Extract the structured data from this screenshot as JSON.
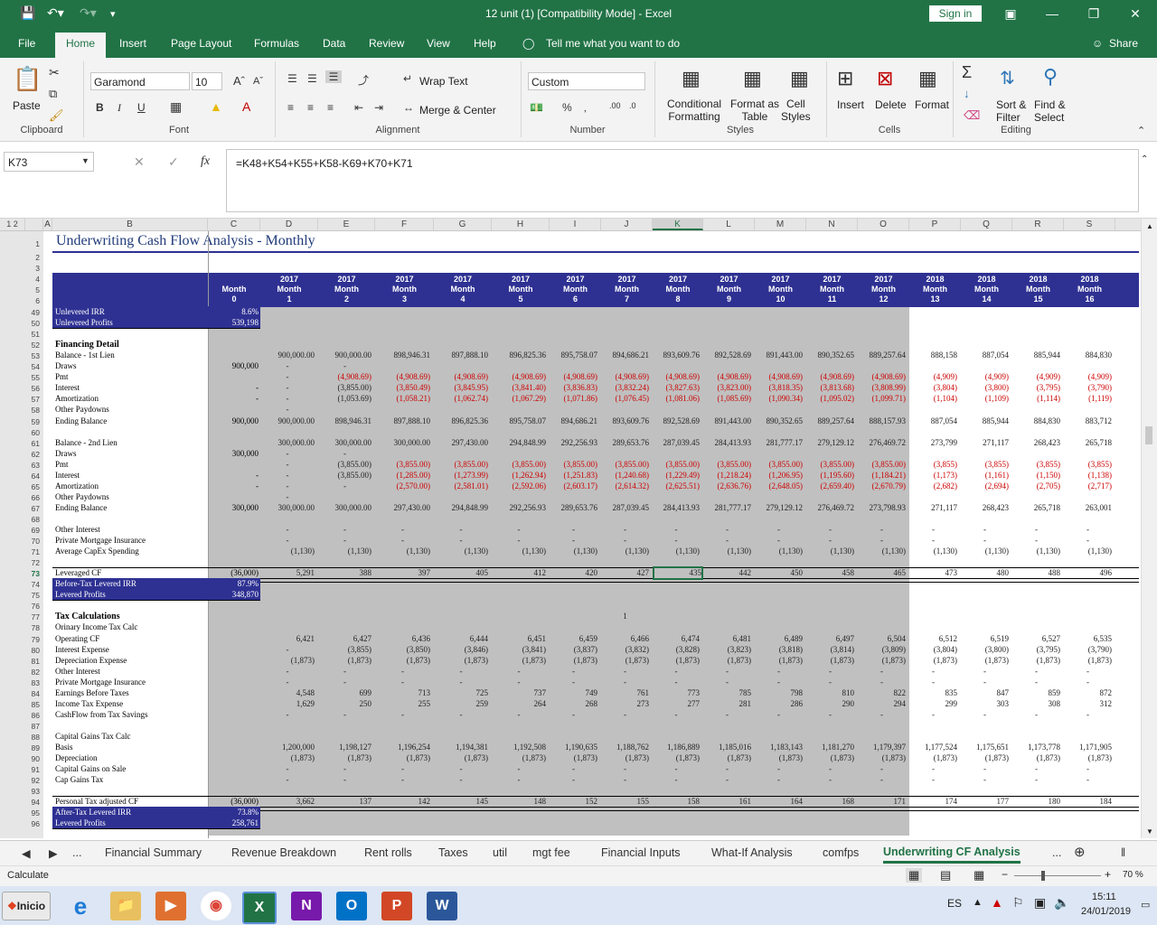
{
  "window": {
    "title": "12 unit (1)  [Compatibility Mode]  -  Excel",
    "sign_in": "Sign in"
  },
  "menu": [
    "File",
    "Home",
    "Insert",
    "Page Layout",
    "Formulas",
    "Data",
    "Review",
    "View",
    "Help"
  ],
  "tell_me": "Tell me what you want to do",
  "share": "Share",
  "ribbon": {
    "paste": "Paste",
    "font_name": "Garamond",
    "font_size": "10",
    "wrap_text": "Wrap Text",
    "merge_center": "Merge & Center",
    "number_format": "Custom",
    "cond_format": [
      "Conditional",
      "Formatting"
    ],
    "format_table": [
      "Format as",
      "Table"
    ],
    "cell_styles": [
      "Cell",
      "Styles"
    ],
    "insert": "Insert",
    "delete": "Delete",
    "format": "Format",
    "sort_filter": [
      "Sort &",
      "Filter"
    ],
    "find_select": [
      "Find &",
      "Select"
    ],
    "groups": [
      "Clipboard",
      "Font",
      "Alignment",
      "Number",
      "Styles",
      "Cells",
      "Editing"
    ]
  },
  "namebox": "K73",
  "fx": "fx",
  "formula": "=K48+K54+K55+K58-K69+K70+K71",
  "columns": [
    "A",
    "B",
    "C",
    "D",
    "E",
    "F",
    "G",
    "H",
    "I",
    "J",
    "K",
    "L",
    "M",
    "N",
    "O",
    "P",
    "Q",
    "R",
    "S"
  ],
  "title": "Underwriting Cash Flow Analysis - Monthly",
  "header": {
    "c": [
      "Month",
      "0"
    ],
    "months": [
      [
        "2017",
        "Month",
        "1"
      ],
      [
        "2017",
        "Month",
        "2"
      ],
      [
        "2017",
        "Month",
        "3"
      ],
      [
        "2017",
        "Month",
        "4"
      ],
      [
        "2017",
        "Month",
        "5"
      ],
      [
        "2017",
        "Month",
        "6"
      ],
      [
        "2017",
        "Month",
        "7"
      ],
      [
        "2017",
        "Month",
        "8"
      ],
      [
        "2017",
        "Month",
        "9"
      ],
      [
        "2017",
        "Month",
        "10"
      ],
      [
        "2017",
        "Month",
        "11"
      ],
      [
        "2017",
        "Month",
        "12"
      ],
      [
        "2018",
        "Month",
        "13"
      ],
      [
        "2018",
        "Month",
        "14"
      ],
      [
        "2018",
        "Month",
        "15"
      ],
      [
        "2018",
        "Month",
        "16"
      ]
    ]
  },
  "row_numbers": [
    "1",
    "2",
    "3",
    "4",
    "5",
    "6",
    "49",
    "50",
    "51",
    "52",
    "53",
    "54",
    "55",
    "56",
    "57",
    "58",
    "59",
    "60",
    "61",
    "62",
    "63",
    "64",
    "65",
    "66",
    "67",
    "68",
    "69",
    "70",
    "71",
    "72",
    "73",
    "74",
    "75",
    "76",
    "77",
    "78",
    "79",
    "80",
    "81",
    "82",
    "83",
    "84",
    "85",
    "86",
    "87",
    "88",
    "89",
    "90",
    "91",
    "92",
    "93",
    "94",
    "95",
    "96"
  ],
  "rows": [
    {
      "r": 49,
      "label": "Unlevered IRR",
      "box": true,
      "c": "8.6%",
      "v": []
    },
    {
      "r": 50,
      "label": "Unlevered Profits",
      "box": true,
      "c": "539,198",
      "v": []
    },
    {
      "r": 52,
      "label": "Financing Detail",
      "bold": true,
      "v": []
    },
    {
      "r": 53,
      "label": "Balance - 1st Lien",
      "c": "",
      "v": [
        "900,000.00",
        "900,000.00",
        "898,946.31",
        "897,888.10",
        "896,825.36",
        "895,758.07",
        "894,686.21",
        "893,609.76",
        "892,528.69",
        "891,443.00",
        "890,352.65",
        "889,257.64",
        "888,158",
        "887,054",
        "885,944",
        "884,830"
      ]
    },
    {
      "r": 54,
      "label": "Draws",
      "c": "900,000",
      "v": [
        "-",
        "-",
        "",
        "",
        "",
        "",
        "",
        "",
        "",
        "",
        "",
        "",
        "",
        "",
        "",
        ""
      ]
    },
    {
      "r": 55,
      "label": "Pmt",
      "c": "",
      "v": [
        "-",
        "(4,908.69)",
        "(4,908.69)",
        "(4,908.69)",
        "(4,908.69)",
        "(4,908.69)",
        "(4,908.69)",
        "(4,908.69)",
        "(4,908.69)",
        "(4,908.69)",
        "(4,908.69)",
        "(4,908.69)",
        "(4,909)",
        "(4,909)",
        "(4,909)",
        "(4,909)"
      ]
    },
    {
      "r": 56,
      "label": "Interest",
      "c": "-",
      "v": [
        "-",
        "(3,855.00)",
        "(3,850.49)",
        "(3,845.95)",
        "(3,841.40)",
        "(3,836.83)",
        "(3,832.24)",
        "(3,827.63)",
        "(3,823.00)",
        "(3,818.35)",
        "(3,813.68)",
        "(3,808.99)",
        "(3,804)",
        "(3,800)",
        "(3,795)",
        "(3,790)"
      ]
    },
    {
      "r": 57,
      "label": "Amortization",
      "c": "-",
      "v": [
        "-",
        "(1,053.69)",
        "(1,058.21)",
        "(1,062.74)",
        "(1,067.29)",
        "(1,071.86)",
        "(1,076.45)",
        "(1,081.06)",
        "(1,085.69)",
        "(1,090.34)",
        "(1,095.02)",
        "(1,099.71)",
        "(1,104)",
        "(1,109)",
        "(1,114)",
        "(1,119)"
      ]
    },
    {
      "r": 58,
      "label": "Other Paydowns",
      "c": "",
      "v": [
        "-",
        "",
        "",
        "",
        "",
        "",
        "",
        "",
        "",
        "",
        "",
        "",
        "",
        "",
        "",
        ""
      ]
    },
    {
      "r": 59,
      "label": "Ending Balance",
      "c": "900,000",
      "v": [
        "900,000.00",
        "898,946.31",
        "897,888.10",
        "896,825.36",
        "895,758.07",
        "894,686.21",
        "893,609.76",
        "892,528.69",
        "891,443.00",
        "890,352.65",
        "889,257.64",
        "888,157.93",
        "887,054",
        "885,944",
        "884,830",
        "883,712"
      ]
    },
    {
      "r": 61,
      "label": "Balance - 2nd Lien",
      "c": "",
      "v": [
        "300,000.00",
        "300,000.00",
        "300,000.00",
        "297,430.00",
        "294,848.99",
        "292,256.93",
        "289,653.76",
        "287,039.45",
        "284,413.93",
        "281,777.17",
        "279,129.12",
        "276,469.72",
        "273,799",
        "271,117",
        "268,423",
        "265,718"
      ]
    },
    {
      "r": 62,
      "label": "Draws",
      "c": "300,000",
      "v": [
        "-",
        "-",
        "",
        "",
        "",
        "",
        "",
        "",
        "",
        "",
        "",
        "",
        "",
        "",
        "",
        ""
      ]
    },
    {
      "r": 63,
      "label": "Pmt",
      "c": "",
      "v": [
        "-",
        "(3,855.00)",
        "(3,855.00)",
        "(3,855.00)",
        "(3,855.00)",
        "(3,855.00)",
        "(3,855.00)",
        "(3,855.00)",
        "(3,855.00)",
        "(3,855.00)",
        "(3,855.00)",
        "(3,855.00)",
        "(3,855)",
        "(3,855)",
        "(3,855)",
        "(3,855)"
      ]
    },
    {
      "r": 64,
      "label": "Interest",
      "c": "-",
      "v": [
        "-",
        "(3,855.00)",
        "(1,285.00)",
        "(1,273.99)",
        "(1,262.94)",
        "(1,251.83)",
        "(1,240.68)",
        "(1,229.49)",
        "(1,218.24)",
        "(1,206.95)",
        "(1,195.60)",
        "(1,184.21)",
        "(1,173)",
        "(1,161)",
        "(1,150)",
        "(1,138)"
      ]
    },
    {
      "r": 65,
      "label": "Amortization",
      "c": "-",
      "v": [
        "-",
        "-",
        "(2,570.00)",
        "(2,581.01)",
        "(2,592.06)",
        "(2,603.17)",
        "(2,614.32)",
        "(2,625.51)",
        "(2,636.76)",
        "(2,648.05)",
        "(2,659.40)",
        "(2,670.79)",
        "(2,682)",
        "(2,694)",
        "(2,705)",
        "(2,717)"
      ]
    },
    {
      "r": 66,
      "label": "Other Paydowns",
      "c": "",
      "v": [
        "-",
        "",
        "",
        "",
        "",
        "",
        "",
        "",
        "",
        "",
        "",
        "",
        "",
        "",
        "",
        ""
      ]
    },
    {
      "r": 67,
      "label": "Ending Balance",
      "c": "300,000",
      "v": [
        "300,000.00",
        "300,000.00",
        "297,430.00",
        "294,848.99",
        "292,256.93",
        "289,653.76",
        "287,039.45",
        "284,413.93",
        "281,777.17",
        "279,129.12",
        "276,469.72",
        "273,798.93",
        "271,117",
        "268,423",
        "265,718",
        "263,001"
      ]
    },
    {
      "r": 69,
      "label": "Other Interest",
      "c": "",
      "v": [
        "-",
        "-",
        "-",
        "-",
        "-",
        "-",
        "-",
        "-",
        "-",
        "-",
        "-",
        "-",
        "-",
        "-",
        "-",
        "-"
      ]
    },
    {
      "r": 70,
      "label": "Private Mortgage Insurance",
      "c": "",
      "v": [
        "-",
        "-",
        "-",
        "-",
        "-",
        "-",
        "-",
        "-",
        "-",
        "-",
        "-",
        "-",
        "-",
        "-",
        "-",
        "-"
      ]
    },
    {
      "r": 71,
      "label": "Average CapEx Spending",
      "c": "",
      "v": [
        "(1,130)",
        "(1,130)",
        "(1,130)",
        "(1,130)",
        "(1,130)",
        "(1,130)",
        "(1,130)",
        "(1,130)",
        "(1,130)",
        "(1,130)",
        "(1,130)",
        "(1,130)",
        "(1,130)",
        "(1,130)",
        "(1,130)",
        "(1,130)"
      ]
    },
    {
      "r": 73,
      "label": "Leveraged CF",
      "line": true,
      "c": "(36,000)",
      "v": [
        "5,291",
        "388",
        "397",
        "405",
        "412",
        "420",
        "427",
        "435",
        "442",
        "450",
        "458",
        "465",
        "473",
        "480",
        "488",
        "496"
      ]
    },
    {
      "r": 74,
      "label": "Before-Tax Levered IRR",
      "box": true,
      "c": "87.9%",
      "v": []
    },
    {
      "r": 75,
      "label": "Levered Profits",
      "box": true,
      "c": "348,870",
      "v": []
    },
    {
      "r": 77,
      "label": "Tax Calculations",
      "bold": true,
      "v": [
        "",
        "",
        "",
        "",
        "",
        "",
        "1",
        "",
        "",
        "",
        "",
        "",
        "",
        "",
        "",
        ""
      ]
    },
    {
      "r": 78,
      "label": "Orinary Income Tax Calc",
      "c": "",
      "v": []
    },
    {
      "r": 79,
      "label": "Operating CF",
      "c": "",
      "v": [
        "6,421",
        "6,427",
        "6,436",
        "6,444",
        "6,451",
        "6,459",
        "6,466",
        "6,474",
        "6,481",
        "6,489",
        "6,497",
        "6,504",
        "6,512",
        "6,519",
        "6,527",
        "6,535"
      ]
    },
    {
      "r": 80,
      "label": "Interest Expense",
      "c": "",
      "v": [
        "-",
        "(3,855)",
        "(3,850)",
        "(3,846)",
        "(3,841)",
        "(3,837)",
        "(3,832)",
        "(3,828)",
        "(3,823)",
        "(3,818)",
        "(3,814)",
        "(3,809)",
        "(3,804)",
        "(3,800)",
        "(3,795)",
        "(3,790)"
      ]
    },
    {
      "r": 81,
      "label": "Depreciation Expense",
      "c": "",
      "v": [
        "(1,873)",
        "(1,873)",
        "(1,873)",
        "(1,873)",
        "(1,873)",
        "(1,873)",
        "(1,873)",
        "(1,873)",
        "(1,873)",
        "(1,873)",
        "(1,873)",
        "(1,873)",
        "(1,873)",
        "(1,873)",
        "(1,873)",
        "(1,873)"
      ]
    },
    {
      "r": 82,
      "label": "Other Interest",
      "c": "",
      "v": [
        "-",
        "-",
        "-",
        "-",
        "-",
        "-",
        "-",
        "-",
        "-",
        "-",
        "-",
        "-",
        "-",
        "-",
        "-",
        "-"
      ]
    },
    {
      "r": 83,
      "label": "Private Mortgage Insurance",
      "c": "",
      "v": [
        "-",
        "-",
        "-",
        "-",
        "-",
        "-",
        "-",
        "-",
        "-",
        "-",
        "-",
        "-",
        "-",
        "-",
        "-",
        "-"
      ]
    },
    {
      "r": 84,
      "label": "Earnings Before Taxes",
      "c": "",
      "v": [
        "4,548",
        "699",
        "713",
        "725",
        "737",
        "749",
        "761",
        "773",
        "785",
        "798",
        "810",
        "822",
        "835",
        "847",
        "859",
        "872"
      ]
    },
    {
      "r": 85,
      "label": "Income Tax Expense",
      "c": "",
      "v": [
        "1,629",
        "250",
        "255",
        "259",
        "264",
        "268",
        "273",
        "277",
        "281",
        "286",
        "290",
        "294",
        "299",
        "303",
        "308",
        "312"
      ]
    },
    {
      "r": 86,
      "label": "CashFlow from Tax Savings",
      "c": "",
      "v": [
        "-",
        "-",
        "-",
        "-",
        "-",
        "-",
        "-",
        "-",
        "-",
        "-",
        "-",
        "-",
        "-",
        "-",
        "-",
        "-"
      ]
    },
    {
      "r": 88,
      "label": "Capital Gains Tax Calc",
      "c": "",
      "v": []
    },
    {
      "r": 89,
      "label": "Basis",
      "c": "",
      "v": [
        "1,200,000",
        "1,198,127",
        "1,196,254",
        "1,194,381",
        "1,192,508",
        "1,190,635",
        "1,188,762",
        "1,186,889",
        "1,185,016",
        "1,183,143",
        "1,181,270",
        "1,179,397",
        "1,177,524",
        "1,175,651",
        "1,173,778",
        "1,171,905"
      ]
    },
    {
      "r": 90,
      "label": "Depreciation",
      "c": "",
      "v": [
        "(1,873)",
        "(1,873)",
        "(1,873)",
        "(1,873)",
        "(1,873)",
        "(1,873)",
        "(1,873)",
        "(1,873)",
        "(1,873)",
        "(1,873)",
        "(1,873)",
        "(1,873)",
        "(1,873)",
        "(1,873)",
        "(1,873)",
        "(1,873)"
      ]
    },
    {
      "r": 91,
      "label": "Capital Gains on Sale",
      "c": "",
      "v": [
        "-",
        "-",
        "-",
        "-",
        "-",
        "-",
        "-",
        "-",
        "-",
        "-",
        "-",
        "-",
        "-",
        "-",
        "-",
        "-"
      ]
    },
    {
      "r": 92,
      "label": "Cap Gains Tax",
      "c": "",
      "v": [
        "-",
        "-",
        "-",
        "-",
        "-",
        "-",
        "-",
        "-",
        "-",
        "-",
        "-",
        "-",
        "-",
        "-",
        "-",
        "-"
      ]
    },
    {
      "r": 94,
      "label": "Personal Tax adjusted CF",
      "line": true,
      "c": "(36,000)",
      "v": [
        "3,662",
        "137",
        "142",
        "145",
        "148",
        "152",
        "155",
        "158",
        "161",
        "164",
        "168",
        "171",
        "174",
        "177",
        "180",
        "184"
      ]
    },
    {
      "r": 95,
      "label": "After-Tax Levered IRR",
      "box": true,
      "c": "73.8%",
      "v": []
    },
    {
      "r": 96,
      "label": "Levered Profits",
      "box": true,
      "c": "258,761",
      "v": []
    }
  ],
  "sheet_tabs": [
    "Financial Summary",
    "Revenue Breakdown",
    "Rent rolls",
    "Taxes",
    "util",
    "mgt fee",
    "Financial Inputs",
    "What-If Analysis",
    "comfps",
    "Underwriting CF Analysis"
  ],
  "active_tab": "Underwriting CF Analysis",
  "status": {
    "left": "Calculate",
    "zoom": "70 %"
  },
  "taskbar": {
    "start": "Inicio",
    "lang": "ES",
    "time": "15:11",
    "date": "24/01/2019"
  },
  "colors": {
    "accent": "#217346",
    "header_fill": "#2e3192",
    "gray_fill": "#c0c0c0",
    "negative": "#cc0000"
  }
}
